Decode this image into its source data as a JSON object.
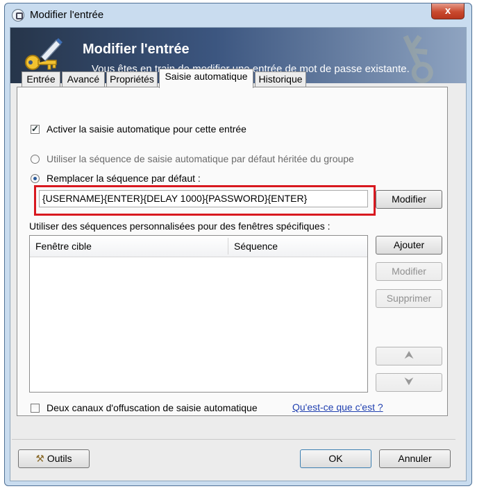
{
  "window": {
    "title": "Modifier l'entrée",
    "close_glyph": "x"
  },
  "banner": {
    "title": "Modifier l'entrée",
    "subtitle": "Vous êtes en train de modifier une entrée de mot de passe existante."
  },
  "tabs": [
    {
      "label": "Entrée",
      "active": false
    },
    {
      "label": "Avancé",
      "active": false
    },
    {
      "label": "Propriétés",
      "active": false
    },
    {
      "label": "Saisie automatique",
      "active": true
    },
    {
      "label": "Historique",
      "active": false
    }
  ],
  "autotype": {
    "enable_label": "Activer la saisie automatique pour cette entrée",
    "enable_checked": true,
    "inherit_label": "Utiliser la séquence de saisie automatique par défaut héritée du groupe",
    "override_label": "Remplacer la séquence par défaut :",
    "override_selected": true,
    "sequence_value": "{USERNAME}{ENTER}{DELAY 1000}{PASSWORD}{ENTER}",
    "modify_label": "Modifier",
    "custom_label": "Utiliser des séquences personnalisées pour des fenêtres spécifiques :",
    "columns": [
      "Fenêtre cible",
      "Séquence"
    ],
    "rows": [],
    "add_label": "Ajouter",
    "edit_label": "Modifier",
    "delete_label": "Supprimer",
    "obfuscation_label": "Deux canaux d'offuscation de saisie automatique",
    "obfuscation_checked": false,
    "help_link": "Qu'est-ce que c'est ?"
  },
  "footer": {
    "tools_label": "Outils",
    "ok_label": "OK",
    "cancel_label": "Annuler"
  },
  "colors": {
    "highlight_box": "#d8181f",
    "banner_dark": "#26354a",
    "link": "#1f3fb0"
  }
}
